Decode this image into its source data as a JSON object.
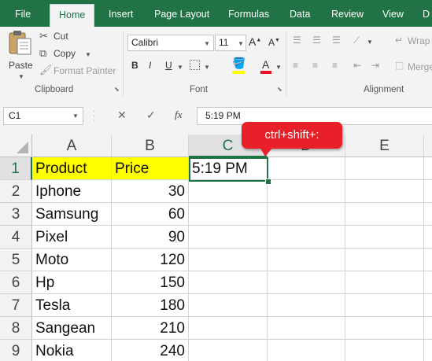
{
  "tabs": [
    "File",
    "Home",
    "Insert",
    "Page Layout",
    "Formulas",
    "Data",
    "Review",
    "View",
    "D"
  ],
  "active_tab": "Home",
  "ribbon": {
    "paste_label": "Paste",
    "cut_label": "Cut",
    "copy_label": "Copy",
    "format_painter_label": "Format Painter",
    "clipboard_group": "Clipboard",
    "font_name": "Calibri",
    "font_size": "11",
    "bold": "B",
    "italic": "I",
    "underline": "U",
    "font_color_glyph": "A",
    "font_group": "Font",
    "wrap_label": "Wrap",
    "merge_label": "Merge",
    "alignment_group": "Alignment",
    "accent_color": "#217346",
    "font_color_bar": "#e81123"
  },
  "formula_bar": {
    "name_box": "C1",
    "cancel_glyph": "✕",
    "enter_glyph": "✓",
    "fx_glyph": "fx",
    "value": "5:19 PM"
  },
  "sheet": {
    "columns": [
      "A",
      "B",
      "C",
      "D",
      "E"
    ],
    "selected_column": "C",
    "rows": [
      {
        "num": "1",
        "a": "Product",
        "b": "Price",
        "c": "5:19 PM"
      },
      {
        "num": "2",
        "a": "Iphone",
        "b": "30",
        "c": ""
      },
      {
        "num": "3",
        "a": "Samsung",
        "b": "60",
        "c": ""
      },
      {
        "num": "4",
        "a": "Pixel",
        "b": "90",
        "c": ""
      },
      {
        "num": "5",
        "a": "Moto",
        "b": "120",
        "c": ""
      },
      {
        "num": "6",
        "a": "Hp",
        "b": "150",
        "c": ""
      },
      {
        "num": "7",
        "a": "Tesla",
        "b": "180",
        "c": ""
      },
      {
        "num": "8",
        "a": "Sangean",
        "b": "210",
        "c": ""
      },
      {
        "num": "9",
        "a": "Nokia",
        "b": "240",
        "c": ""
      }
    ],
    "header_highlight": "#ffff00"
  },
  "callout": {
    "text": "ctrl+shift+:",
    "color": "#e8202a"
  }
}
